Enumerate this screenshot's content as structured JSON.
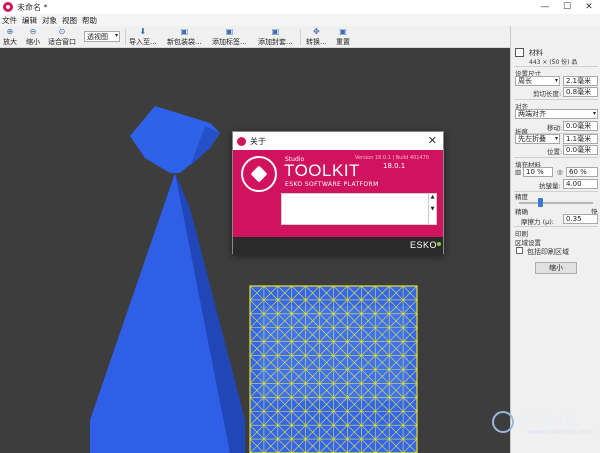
{
  "window": {
    "title": "未命名 *",
    "controls": [
      "—",
      "☐",
      "✕"
    ]
  },
  "menubar": [
    "文件",
    "编辑",
    "对象",
    "视图",
    "帮助"
  ],
  "toolbar": {
    "zoom_in": "放大",
    "zoom_out": "缩小",
    "fit_window": "适合窗口",
    "view_select": "透视图",
    "import": "导入至...",
    "new_bag": "新包装袋...",
    "add_label": "添加标签...",
    "add_cap": "添加封套...",
    "convert": "转换...",
    "reset": "重置"
  },
  "panel": {
    "header_label": "材料",
    "header_sub": "443 × (50 份) 品",
    "length_label": "设置尺寸",
    "length_select": "周长",
    "length_value": "2.1毫米",
    "cut_label": "剪切长度:",
    "cut_value": "0.8毫米",
    "align_label": "对齐",
    "align_select": "两端对齐",
    "move_label": "移动:",
    "move_value": "0.0毫米",
    "gusset_label": "折痕",
    "gusset_select": "先左折叠",
    "gusset_value": "1.1毫米",
    "pos_label": "位置:",
    "pos_value": "0.0毫米",
    "fill_label": "填充材料",
    "fill_pct1": "10 %",
    "fill_pct2": "60 %",
    "wrinkle_label": "抗皱量:",
    "wrinkle_value": "4.00",
    "precision_label": "精度",
    "precise": "精确",
    "fast": "快",
    "friction_label": "摩擦力 (μ):",
    "friction_value": "0.35",
    "print_label": "印刷",
    "area_label": "区域设置",
    "include_label": "包括印刷区域",
    "shrink_button": "缩小"
  },
  "dialog": {
    "title": "关于",
    "studio": "Studio",
    "toolkit": "TOOLKIT",
    "platform": "ESKO SOFTWARE PLATFORM",
    "version_line": "Version 18.0.1 | Build 401470",
    "version": "18.0.1",
    "brand": "ESKO",
    "accent": "#d1135f"
  },
  "watermark": {
    "name": "当下软件园",
    "url": "www.downxia.com"
  }
}
